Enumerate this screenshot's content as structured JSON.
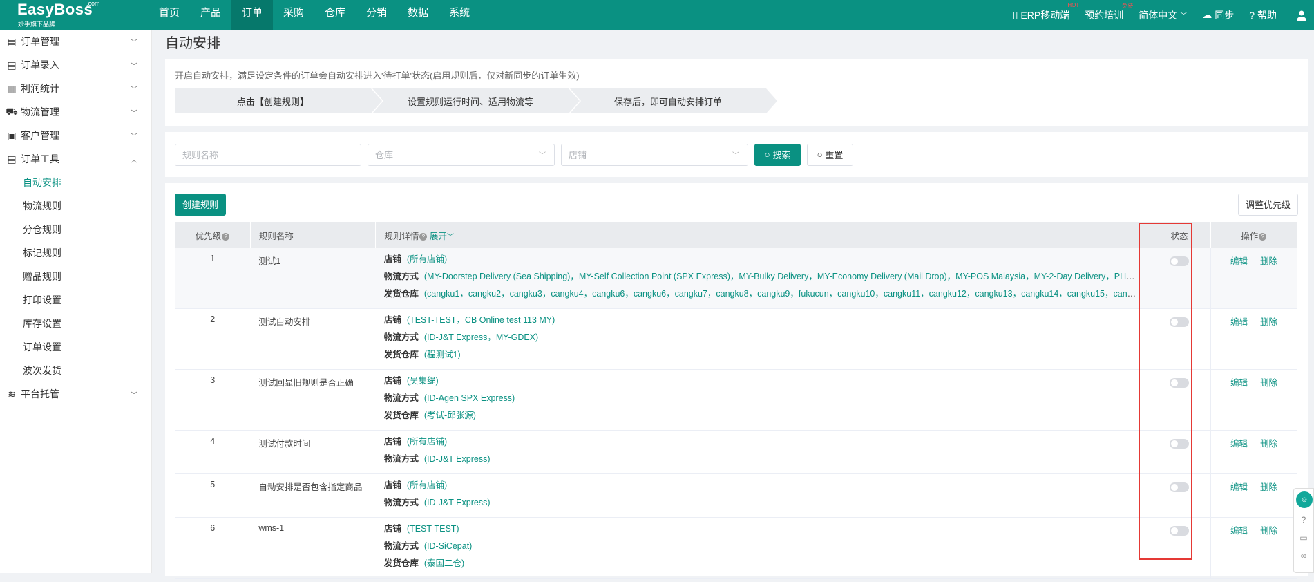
{
  "brand": {
    "name": "EasyBoss",
    "com": ".com",
    "subtitle": "妙手旗下品牌"
  },
  "nav": [
    "首页",
    "产品",
    "订单",
    "采购",
    "仓库",
    "分销",
    "数据",
    "系统"
  ],
  "nav_active_index": 2,
  "topright": {
    "erp": "ERP移动端",
    "erp_tag": "HOT",
    "train": "预约培训",
    "train_tag": "免费",
    "lang": "简体中文",
    "sync": "同步",
    "help": "帮助"
  },
  "sidebar": {
    "groups": [
      {
        "label": "订单管理",
        "icon": "order-icon",
        "expanded": false
      },
      {
        "label": "订单录入",
        "icon": "entry-icon",
        "expanded": false
      },
      {
        "label": "利润统计",
        "icon": "profit-icon",
        "expanded": false
      },
      {
        "label": "物流管理",
        "icon": "truck-icon",
        "expanded": false
      },
      {
        "label": "客户管理",
        "icon": "customer-icon",
        "expanded": false
      },
      {
        "label": "订单工具",
        "icon": "tool-icon",
        "expanded": true
      },
      {
        "label": "平台托管",
        "icon": "platform-icon",
        "expanded": false
      }
    ],
    "tool_items": [
      "自动安排",
      "物流规则",
      "分仓规则",
      "标记规则",
      "赠品规则",
      "打印设置",
      "库存设置",
      "订单设置",
      "波次发货"
    ],
    "tool_active_index": 0
  },
  "page": {
    "title": "自动安排",
    "tip": "开启自动安排，满足设定条件的订单会自动安排进入'待打单'状态(启用规则后，仅对新同步的订单生效)",
    "steps": [
      "点击【创建规则】",
      "设置规则运行时间、适用物流等",
      "保存后，即可自动安排订单"
    ]
  },
  "filters": {
    "rule_name_placeholder": "规则名称",
    "warehouse_placeholder": "仓库",
    "store_placeholder": "店铺",
    "search": "搜索",
    "reset": "重置"
  },
  "toolbar": {
    "create": "创建规则",
    "adjust": "调整优先级"
  },
  "table": {
    "headers": {
      "priority": "优先级",
      "name": "规则名称",
      "detail": "规则详情",
      "expand": "展开",
      "status": "状态",
      "op": "操作"
    },
    "labels": {
      "store": "店铺",
      "logistics": "物流方式",
      "warehouse": "发货仓库"
    },
    "op_edit": "编辑",
    "op_delete": "删除",
    "rows": [
      {
        "priority": "1",
        "name": "测试1",
        "store": "(所有店铺)",
        "logistics": "(MY-Doorstep Delivery (Sea Shipping)，MY-Self Collection Point (SPX Express)，MY-Bulky Delivery，MY-Economy Delivery (Mail Drop)，MY-POS Malaysia，MY-2-Day Delivery，PH-St...",
        "warehouse": "(cangku1，cangku2，cangku3，cangku4，cangku6，cangku6，cangku7，cangku8，cangku9，fukucun，cangku10，cangku11，cangku12，cangku13，cangku14，cangku15，cangku...",
        "enabled": false
      },
      {
        "priority": "2",
        "name": "测试自动安排",
        "store": "(TEST-TEST，CB Online test 113 MY)",
        "logistics": "(ID-J&T Express，MY-GDEX)",
        "warehouse": "(程测试1)",
        "enabled": false
      },
      {
        "priority": "3",
        "name": "测试回显旧规则是否正确",
        "store": "(吴集缇)",
        "logistics": "(ID-Agen SPX Express)",
        "warehouse": "(考试-邱张源)",
        "enabled": false
      },
      {
        "priority": "4",
        "name": "测试付款时间",
        "store": "(所有店铺)",
        "logistics": "(ID-J&T Express)",
        "warehouse": "",
        "enabled": false
      },
      {
        "priority": "5",
        "name": "自动安排是否包含指定商品",
        "store": "(所有店铺)",
        "logistics": "(ID-J&T Express)",
        "warehouse": "",
        "enabled": false
      },
      {
        "priority": "6",
        "name": "wms-1",
        "store": "(TEST-TEST)",
        "logistics": "(ID-SiCepat)",
        "warehouse": "(泰国二仓)",
        "enabled": false
      }
    ]
  },
  "colors": {
    "brand": "#0a9182",
    "highlight_box": "#e53935"
  }
}
